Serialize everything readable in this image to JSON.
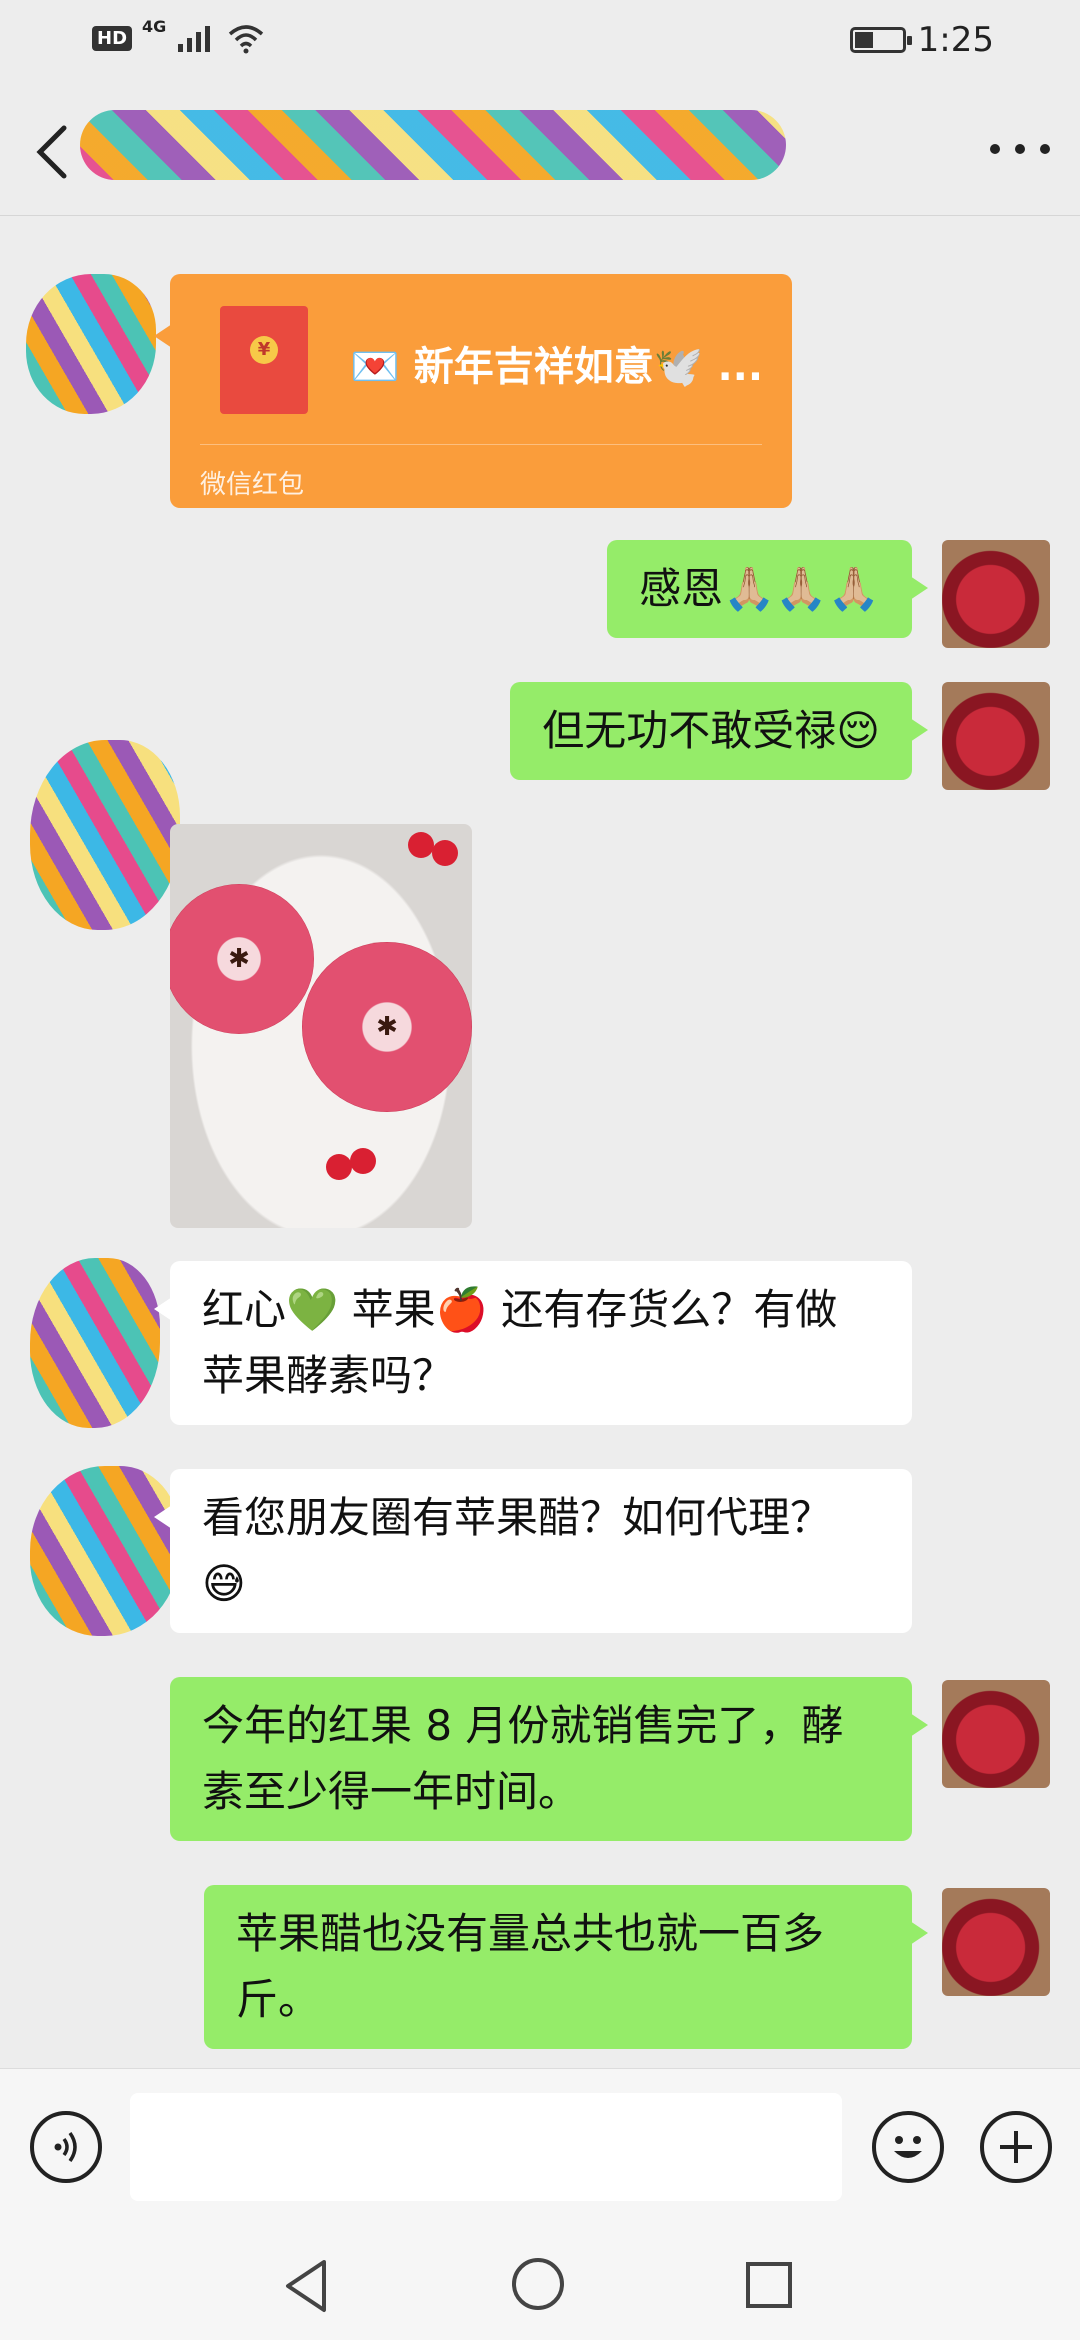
{
  "status_bar": {
    "hd_label": "HD",
    "network_label": "4G",
    "time": "1:25"
  },
  "nav": {
    "title": "",
    "more_icon": "more-dots-icon",
    "back_icon": "chevron-left-icon"
  },
  "messages": {
    "red_packet": {
      "title": "💌 新年吉祥如意🕊️ ...",
      "footer": "微信红包",
      "coin": "¥"
    },
    "m1": "感恩🙏🏼🙏🏼🙏🏼",
    "m2": "但无功不敢受禄😌",
    "m3_line1": "红心💚 苹果🍎 还有存货么？有做",
    "m3_line2": "苹果酵素吗？",
    "m4_line1": "看您朋友圈有苹果醋？如何代理？",
    "m4_line2": "😅",
    "m5_line1": "今年的红果 8 月份就销售完了，酵",
    "m5_line2": "素至少得一年时间。",
    "m6_line1": "苹果醋也没有量总共也就一百多",
    "m6_line2": "斤。"
  },
  "input_bar": {
    "placeholder": "",
    "voice_icon": "voice-icon",
    "emoji_icon": "emoji-icon",
    "plus_icon": "plus-icon"
  },
  "colors": {
    "sent_bubble": "#95ec69",
    "received_bubble": "#ffffff",
    "red_packet": "#fa9d3b",
    "background": "#ededed"
  }
}
